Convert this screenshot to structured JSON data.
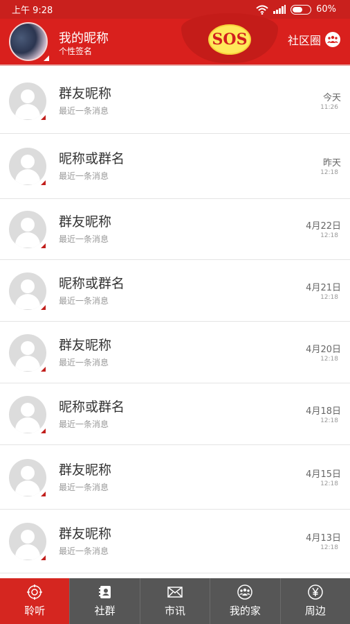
{
  "status_bar": {
    "time": "上午 9:28",
    "battery": "60%",
    "battery_level": 0.6
  },
  "header": {
    "nickname": "我的昵称",
    "signature": "个性签名",
    "sos_label": "SOS",
    "community_label": "社区圈"
  },
  "chats": [
    {
      "title": "群友昵称",
      "message": "最近一条消息",
      "date": "今天",
      "time": "11:26"
    },
    {
      "title": "昵称或群名",
      "message": "最近一条消息",
      "date": "昨天",
      "time": "12:18"
    },
    {
      "title": "群友昵称",
      "message": "最近一条消息",
      "date": "4月22日",
      "time": "12:18"
    },
    {
      "title": "昵称或群名",
      "message": "最近一条消息",
      "date": "4月21日",
      "time": "12:18"
    },
    {
      "title": "群友昵称",
      "message": "最近一条消息",
      "date": "4月20日",
      "time": "12:18"
    },
    {
      "title": "昵称或群名",
      "message": "最近一条消息",
      "date": "4月18日",
      "time": "12:18"
    },
    {
      "title": "群友昵称",
      "message": "最近一条消息",
      "date": "4月15日",
      "time": "12:18"
    },
    {
      "title": "群友昵称",
      "message": "最近一条消息",
      "date": "4月13日",
      "time": "12:18"
    }
  ],
  "nav": [
    {
      "label": "聆听",
      "icon": "target-icon",
      "active": true
    },
    {
      "label": "社群",
      "icon": "contacts-book-icon",
      "active": false
    },
    {
      "label": "市讯",
      "icon": "mail-icon",
      "active": false
    },
    {
      "label": "我的家",
      "icon": "family-icon",
      "active": false
    },
    {
      "label": "周边",
      "icon": "yuan-icon",
      "active": false
    }
  ],
  "colors": {
    "brand_red": "#d9201d",
    "nav_bg": "#565656",
    "nav_active": "#d52620",
    "sos_yellow": "#ffe95a"
  }
}
